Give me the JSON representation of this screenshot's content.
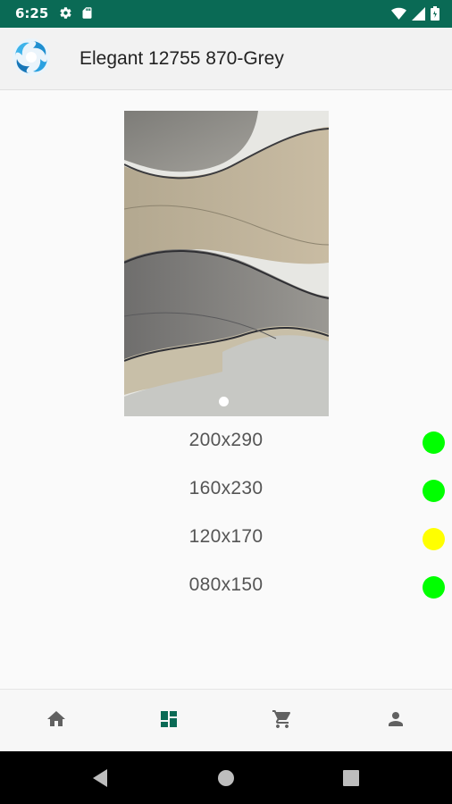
{
  "status_bar": {
    "time": "6:25",
    "background_color": "#0a6a55",
    "left_icons": [
      "gear-icon",
      "sd-card-icon"
    ],
    "right_icons": [
      "wifi-icon",
      "signal-icon",
      "battery-icon"
    ]
  },
  "app_bar": {
    "title": "Elegant 12755 870-Grey",
    "logo_icon": "app-logo-icon"
  },
  "carousel": {
    "active_index": 0,
    "image_description_icon": "rug-product-image"
  },
  "sizes": [
    {
      "label": "200x290",
      "status_color": "#00ff00"
    },
    {
      "label": "160x230",
      "status_color": "#00ff00"
    },
    {
      "label": "120x170",
      "status_color": "#ffff00"
    },
    {
      "label": "080x150",
      "status_color": "#00ff00"
    }
  ],
  "bottom_nav": {
    "items": [
      {
        "icon": "home-icon",
        "active": false
      },
      {
        "icon": "dashboard-icon",
        "active": true
      },
      {
        "icon": "cart-icon",
        "active": false
      },
      {
        "icon": "person-icon",
        "active": false
      }
    ],
    "active_color": "#0a6a55",
    "inactive_color": "#616161"
  },
  "system_nav": {
    "buttons": [
      "back-icon",
      "home-circle-icon",
      "recents-icon"
    ]
  }
}
